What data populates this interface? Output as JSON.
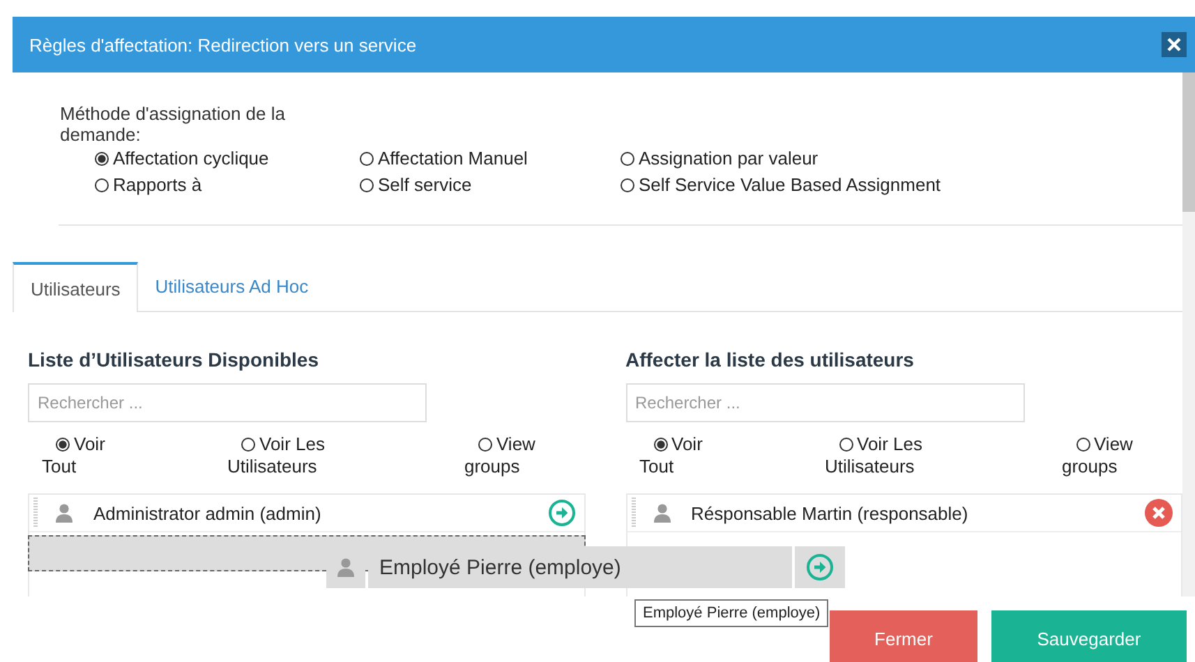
{
  "dialog": {
    "title": "Règles d'affectation: Redirection vers un service"
  },
  "method": {
    "label": "Méthode d'assignation de la demande:",
    "options": [
      {
        "label": "Affectation cyclique",
        "selected": true
      },
      {
        "label": "Affectation Manuel",
        "selected": false
      },
      {
        "label": "Assignation par valeur",
        "selected": false
      },
      {
        "label": "Rapports à",
        "selected": false
      },
      {
        "label": "Self service",
        "selected": false
      },
      {
        "label": "Self Service Value Based Assignment",
        "selected": false
      }
    ]
  },
  "tabs": [
    {
      "label": "Utilisateurs",
      "selected": true
    },
    {
      "label": "Utilisateurs Ad Hoc",
      "selected": false
    }
  ],
  "panels": [
    {
      "title": "Liste d’Utilisateurs Disponibles",
      "search": {
        "placeholder": "Rechercher ..."
      },
      "filters": [
        {
          "label": "Voir Tout",
          "selected": true
        },
        {
          "label": "Voir Les Utilisateurs",
          "selected": false
        },
        {
          "label": "View groups",
          "selected": false
        }
      ],
      "items": [
        {
          "name": "Administrator admin (admin)",
          "kind": "add"
        }
      ],
      "drop_placeholder": true
    },
    {
      "title": "Affecter la liste des utilisateurs",
      "search": {
        "placeholder": "Rechercher ..."
      },
      "filters": [
        {
          "label": "Voir Tout",
          "selected": true
        },
        {
          "label": "Voir Les Utilisateurs",
          "selected": false
        },
        {
          "label": "View groups",
          "selected": false
        }
      ],
      "items": [
        {
          "name": "Résponsable Martin (responsable)",
          "kind": "remove"
        }
      ],
      "drop_placeholder": false
    }
  ],
  "dragging": {
    "name": "Employé Pierre (employe)",
    "kind": "add",
    "tooltip": "Employé Pierre (employe)"
  },
  "buttons": [
    {
      "label": "Fermer",
      "kind": "danger"
    },
    {
      "label": "Sauvegarder",
      "kind": "primary"
    }
  ]
}
